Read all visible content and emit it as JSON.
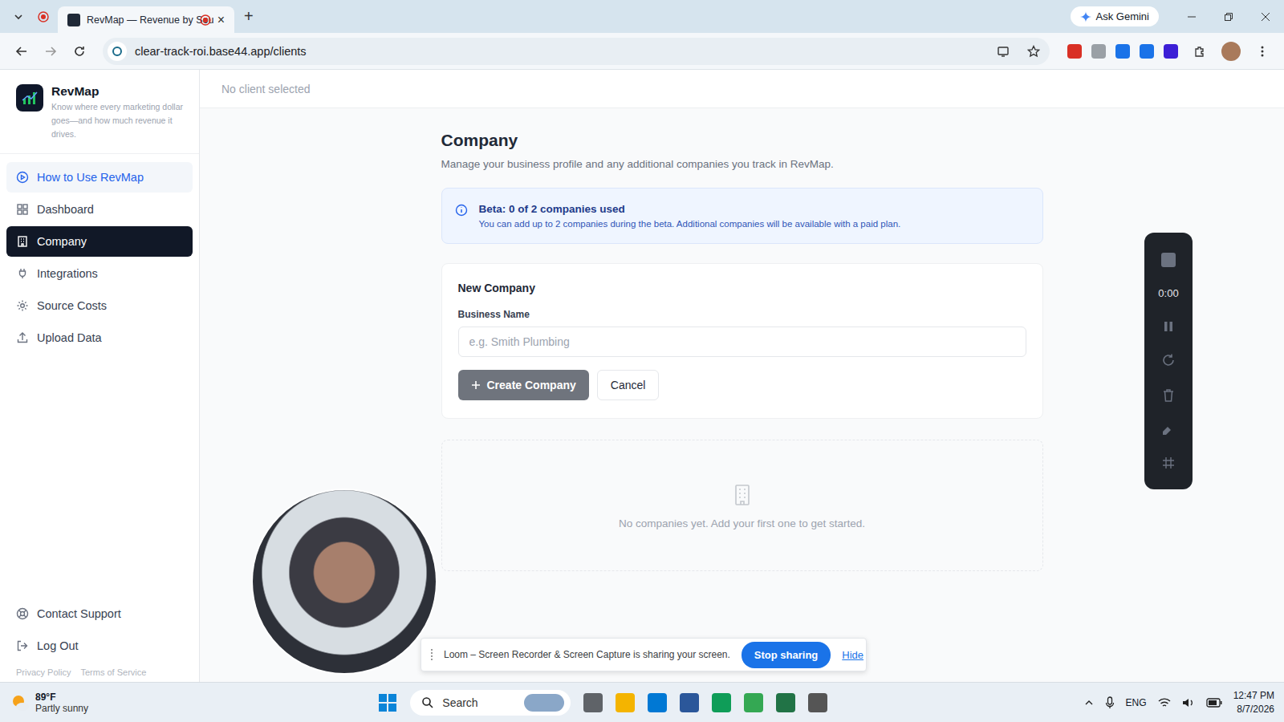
{
  "browser": {
    "tabs": [
      {
        "title": "RevMap — Revenue by Sou",
        "selected": true,
        "recording": true
      }
    ],
    "close": "×",
    "new_tab": "+",
    "ask_gemini": "Ask Gemini",
    "url": "clear-track-roi.base44.app/clients"
  },
  "sidebar": {
    "brand": "RevMap",
    "tagline": "Know where every marketing dollar goes—and how much revenue it drives.",
    "items": [
      {
        "label": "How to Use RevMap",
        "selected": false,
        "highlighted": true
      },
      {
        "label": "Dashboard",
        "selected": false,
        "highlighted": false
      },
      {
        "label": "Company",
        "selected": true,
        "highlighted": false
      },
      {
        "label": "Integrations",
        "selected": false,
        "highlighted": false
      },
      {
        "label": "Source Costs",
        "selected": false,
        "highlighted": false
      },
      {
        "label": "Upload Data",
        "selected": false,
        "highlighted": false
      }
    ],
    "footer_items": [
      "Contact Support",
      "Log Out"
    ],
    "legal": [
      "Privacy Policy",
      "Terms of Service"
    ]
  },
  "topbar": {
    "client": "No client selected"
  },
  "page": {
    "title": "Company",
    "subtitle": "Manage your business profile and any additional companies you track in RevMap."
  },
  "notice": {
    "title": "Beta: 0 of 2 companies used",
    "body": "You can add up to 2 companies during the beta. Additional companies will be available with a paid plan."
  },
  "form": {
    "title": "New Company",
    "field_label": "Business Name",
    "placeholder": "e.g. Smith Plumbing",
    "value": "",
    "submit": {
      "label": "Create Company",
      "disabled": true
    },
    "cancel": "Cancel"
  },
  "empty_state": "No companies yet. Add your first one to get started.",
  "recorder": {
    "timer": "0:00"
  },
  "share_bar": {
    "message": "Loom – Screen Recorder & Screen Capture is sharing your screen.",
    "stop": "Stop sharing",
    "hide": "Hide"
  },
  "taskbar": {
    "temperature": "89°F",
    "weather": "Partly sunny",
    "search": "Search",
    "language": "ENG",
    "time": "12:47 PM",
    "date": "8/7/2026"
  }
}
